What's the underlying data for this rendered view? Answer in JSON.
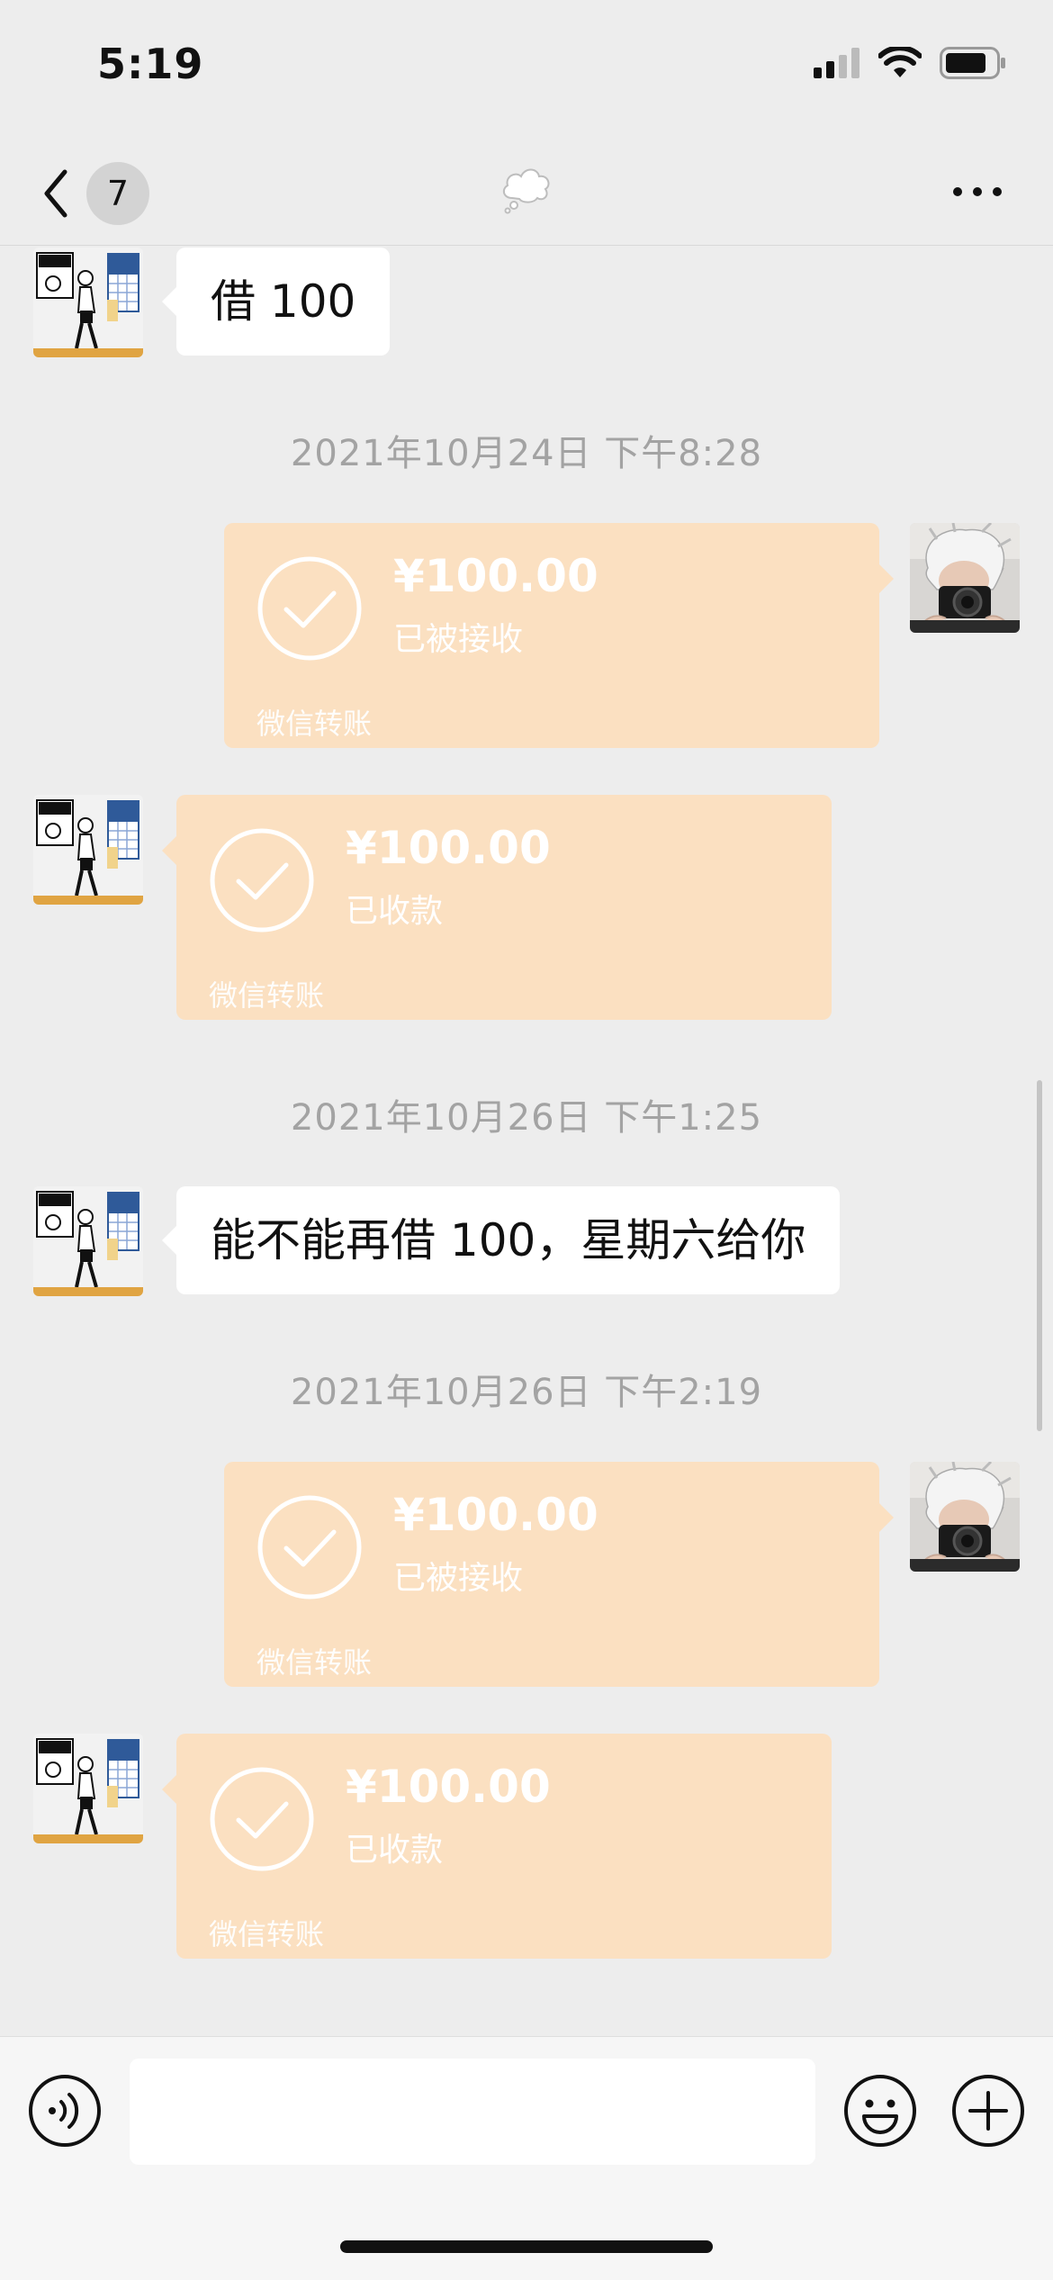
{
  "status_bar": {
    "time": "5:19"
  },
  "nav": {
    "unread_count": "7"
  },
  "messages": [
    {
      "type": "text",
      "side": "left",
      "text": "借 100"
    },
    {
      "type": "timestamp",
      "text": "2021年10月24日 下午8:28"
    },
    {
      "type": "transfer",
      "side": "right",
      "amount": "¥100.00",
      "status": "已被接收",
      "label": "微信转账"
    },
    {
      "type": "transfer",
      "side": "left",
      "amount": "¥100.00",
      "status": "已收款",
      "label": "微信转账"
    },
    {
      "type": "timestamp",
      "text": "2021年10月26日 下午1:25"
    },
    {
      "type": "text",
      "side": "left",
      "text": "能不能再借 100，星期六给你"
    },
    {
      "type": "timestamp",
      "text": "2021年10月26日 下午2:19"
    },
    {
      "type": "transfer",
      "side": "right",
      "amount": "¥100.00",
      "status": "已被接收",
      "label": "微信转账"
    },
    {
      "type": "transfer",
      "side": "left",
      "amount": "¥100.00",
      "status": "已收款",
      "label": "微信转账"
    }
  ],
  "input": {
    "value": ""
  },
  "colors": {
    "background": "#ededed",
    "transfer_bubble": "#fbe0c1",
    "text_bubble": "#ffffff",
    "timestamp": "#a3a3a3"
  },
  "icons": [
    "back-chevron-icon",
    "cloud-icon",
    "more-icon",
    "voice-icon",
    "emoji-icon",
    "plus-icon",
    "check-circle-icon",
    "signal-icon",
    "wifi-icon",
    "battery-icon"
  ]
}
